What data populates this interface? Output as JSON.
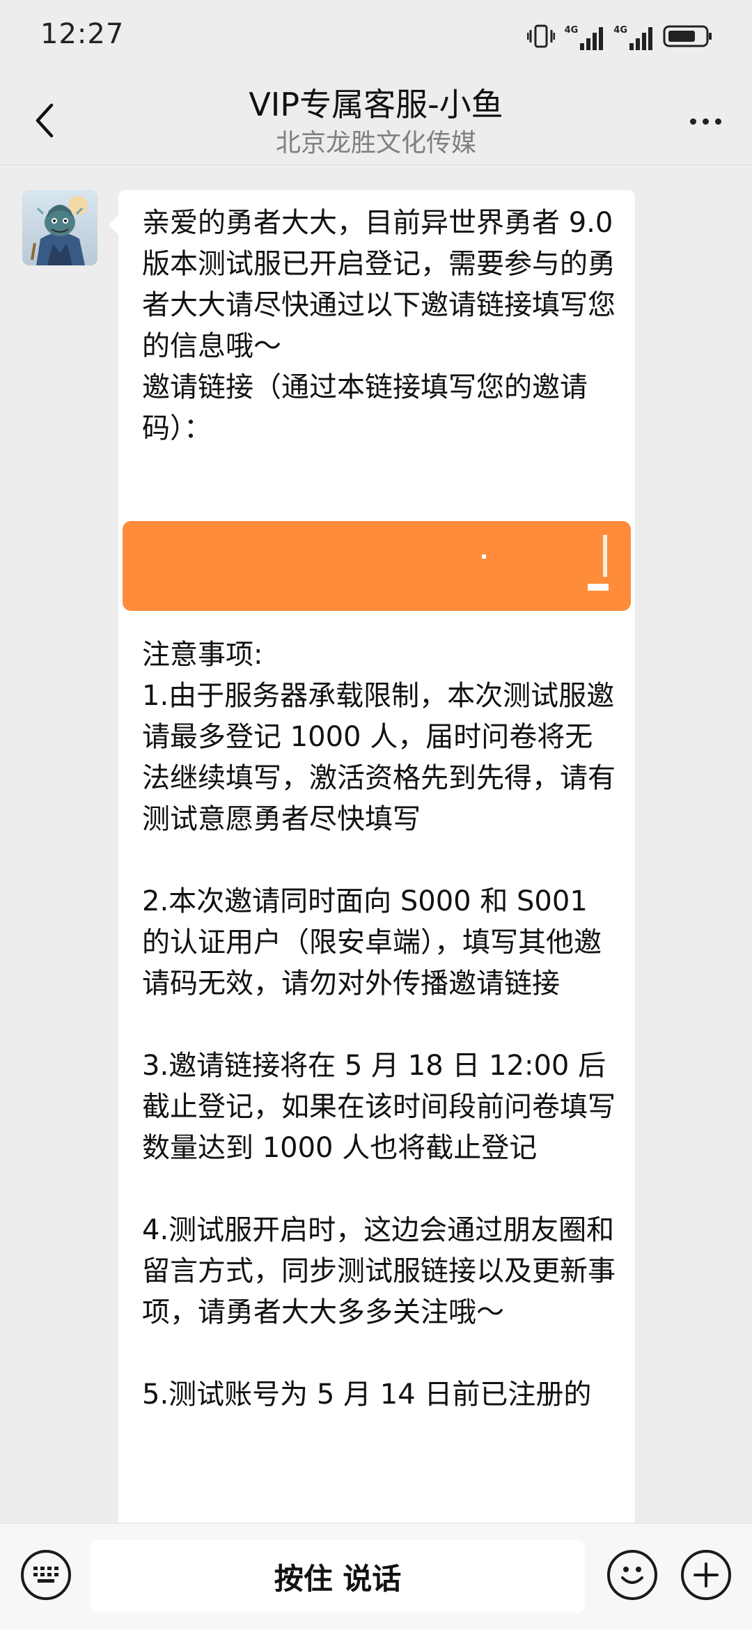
{
  "status_bar": {
    "time": "12:27",
    "icons": [
      "vibrate-icon",
      "signal-4g-icon",
      "signal-4g-icon",
      "battery-icon"
    ],
    "network_labels": [
      "4G",
      "4G"
    ]
  },
  "header": {
    "title": "VIP专属客服-小鱼",
    "subtitle": "北京龙胜文化传媒",
    "back_icon": "chevron-left-icon",
    "more_icon": "more-horizontal-icon"
  },
  "chat": {
    "messages": [
      {
        "sender": "incoming",
        "intro_text": "亲爱的勇者大大，目前异世界勇者 9.0 版本测试服已开启登记，需要参与的勇者大大请尽快通过以下邀请链接填写您的信息哦～\n邀请链接（通过本链接填写您的邀请码）：",
        "link_block_color": "#ff8c3a",
        "notes_text": "注意事项:\n1.由于服务器承载限制，本次测试服邀请最多登记 1000 人，届时问卷将无法继续填写，激活资格先到先得，请有测试意愿勇者尽快填写\n\n2.本次邀请同时面向 S000 和 S001 的认证用户（限安卓端），填写其他邀请码无效，请勿对外传播邀请链接\n\n3.邀请链接将在 5 月 18 日 12:00 后截止登记，如果在该时间段前问卷填写数量达到 1000 人也将截止登记\n\n4.测试服开启时，这边会通过朋友圈和留言方式，同步测试服链接以及更新事项，请勇者大大多多关注哦～\n\n5.测试账号为 5 月 14 日前已注册的"
      }
    ]
  },
  "input_bar": {
    "hold_to_talk_label": "按住 说话",
    "left_icon": "keyboard-icon",
    "emoji_icon": "emoji-smile-icon",
    "plus_icon": "plus-circle-icon"
  },
  "colors": {
    "background": "#ededed",
    "bubble": "#ffffff",
    "link_highlight": "#ff8c3a"
  }
}
